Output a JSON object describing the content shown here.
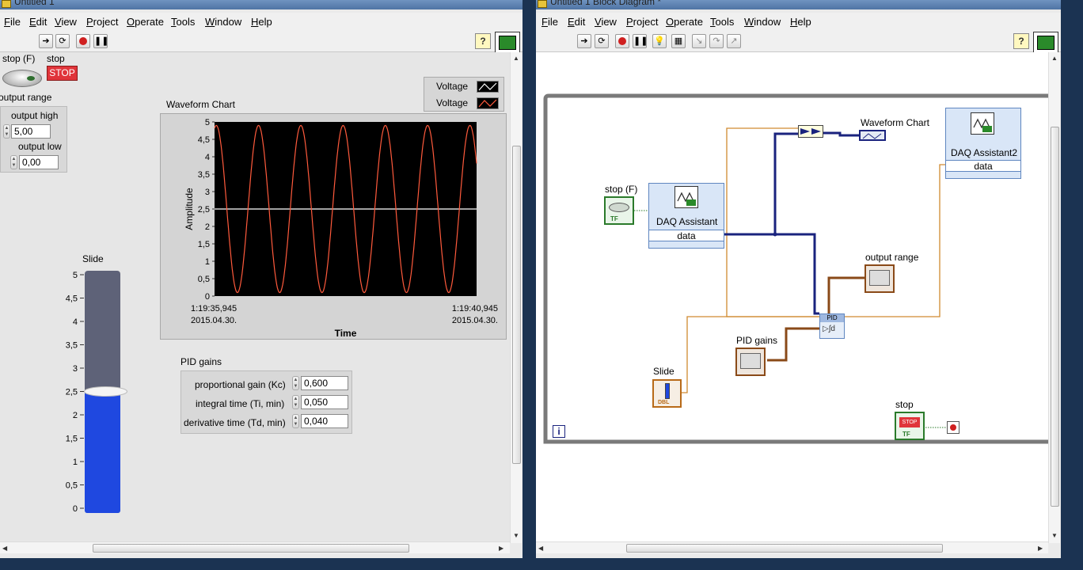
{
  "left_window": {
    "title": "Untitled 1",
    "menu": [
      "File",
      "Edit",
      "View",
      "Project",
      "Operate",
      "Tools",
      "Window",
      "Help"
    ],
    "help_icon": "?",
    "stop_f_label": "stop (F)",
    "stop_label": "stop",
    "stop_button_text": "STOP",
    "output_range": {
      "label": "output range",
      "high_label": "output high",
      "high_value": "5,00",
      "low_label": "output low",
      "low_value": "0,00"
    },
    "legend": [
      "Voltage",
      "Voltage"
    ],
    "chart_title": "Waveform Chart",
    "slide": {
      "label": "Slide",
      "ticks": [
        "5",
        "4,5",
        "4",
        "3,5",
        "3",
        "2,5",
        "2",
        "1,5",
        "1",
        "0,5",
        "0"
      ],
      "value": 2.5
    },
    "pid_gains": {
      "label": "PID gains",
      "rows": [
        {
          "label": "proportional gain (Kc)",
          "value": "0,600"
        },
        {
          "label": "integral time (Ti, min)",
          "value": "0,050"
        },
        {
          "label": "derivative time (Td, min)",
          "value": "0,040"
        }
      ]
    }
  },
  "chart_data": {
    "type": "line",
    "xlabel": "Time",
    "ylabel": "Amplitude",
    "ylim": [
      0,
      5
    ],
    "yticks": [
      "5",
      "4,5",
      "4",
      "3,5",
      "3",
      "2,5",
      "2",
      "1,5",
      "1",
      "0,5",
      "0"
    ],
    "x_start": {
      "time": "1:19:35,945",
      "date": "2015.04.30."
    },
    "x_end": {
      "time": "1:19:40,945",
      "date": "2015.04.30."
    },
    "series": [
      {
        "name": "Voltage",
        "color": "#ffffff",
        "constant": 2.5
      },
      {
        "name": "Voltage",
        "color": "#ff5a3c",
        "sine": {
          "offset": 2.5,
          "amplitude": 2.4,
          "cycles": 6.2,
          "phase_deg": 75
        }
      }
    ],
    "background": "#000000"
  },
  "right_window": {
    "title": "Untitled 1 Block Diagram *",
    "menu": [
      "File",
      "Edit",
      "View",
      "Project",
      "Operate",
      "Tools",
      "Window",
      "Help"
    ],
    "help_icon": "?",
    "nodes": {
      "stop_f": "stop (F)",
      "daq1_title": "DAQ Assistant",
      "daq1_port": "data",
      "waveform_chart": "Waveform Chart",
      "daq2_title": "DAQ Assistant2",
      "daq2_port": "data",
      "output_range": "output range",
      "pid_gains": "PID gains",
      "pid": "PID",
      "slide": "Slide",
      "stop": "stop",
      "stop_button_text": "STOP",
      "loop_info": "i"
    }
  },
  "colors": {
    "desktop": "#1b3352",
    "panel": "#eaeaea",
    "chart_bg": "#000000",
    "sine": "#ff5a3c",
    "slide_fill": "#1f48e0",
    "wire_orange": "#d08a30",
    "wire_blue": "#1a237e",
    "wire_brown": "#8a4a18",
    "stop_red": "#e0343a"
  }
}
